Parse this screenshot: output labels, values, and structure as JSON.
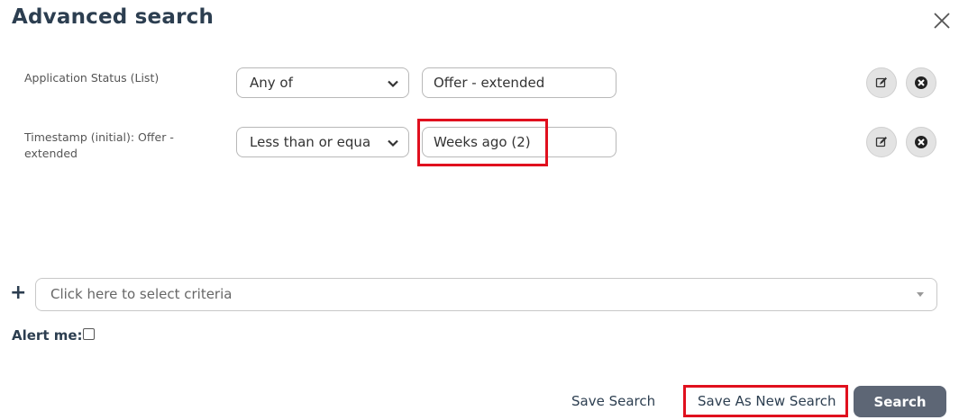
{
  "dialog": {
    "title": "Advanced search",
    "close_icon": "close-icon"
  },
  "criteria_rows": [
    {
      "label": "Application Status (List)",
      "operator": "Any of",
      "value": "Offer - extended"
    },
    {
      "label": "Timestamp (initial): Offer - extended",
      "operator": "Less than or equa",
      "value": "Weeks ago (2)"
    }
  ],
  "row_actions": {
    "edit_icon": "edit-icon",
    "remove_icon": "remove-circle-icon"
  },
  "add_criteria": {
    "plus_icon": "plus-icon",
    "placeholder": "Click here to select criteria"
  },
  "alert": {
    "label": "Alert me:",
    "checked": false
  },
  "footer": {
    "save_search": "Save Search",
    "save_as_new": "Save As New Search",
    "search": "Search"
  },
  "colors": {
    "title": "#2c3e50",
    "highlight": "#e0101e",
    "search_button": "#5d6675"
  }
}
